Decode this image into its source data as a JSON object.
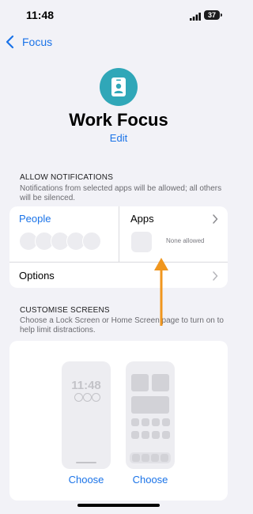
{
  "status_bar": {
    "time": "11:48",
    "battery": "37"
  },
  "nav": {
    "back_label": "Focus"
  },
  "focus": {
    "title": "Work Focus",
    "edit_label": "Edit",
    "icon": "person-badge-icon",
    "accent": "#30a7b8"
  },
  "allow_notifications": {
    "header": "ALLOW NOTIFICATIONS",
    "description": "Notifications from selected apps will be allowed; all others will be silenced.",
    "people_label": "People",
    "apps_label": "Apps",
    "apps_status": "None allowed",
    "options_label": "Options"
  },
  "customise_screens": {
    "header": "CUSTOMISE SCREENS",
    "description": "Choose a Lock Screen or Home Screen page to turn on to help limit distractions.",
    "lock_preview_time": "11:48",
    "lock_choose": "Choose",
    "home_choose": "Choose"
  },
  "colors": {
    "link": "#1a73e8",
    "annotation_arrow": "#f0961e"
  }
}
